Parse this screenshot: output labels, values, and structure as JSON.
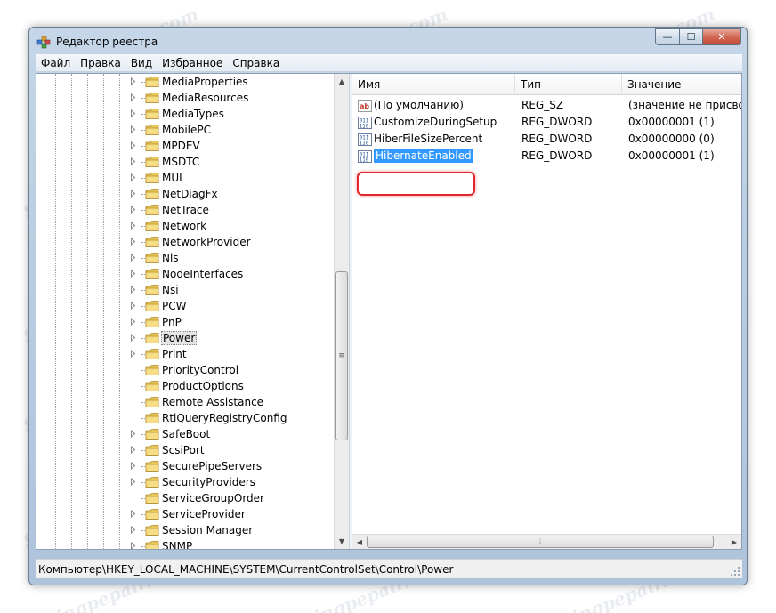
{
  "window": {
    "title": "Редактор реестра",
    "buttons": {
      "minimize": "—",
      "maximize": "☐",
      "close": "✕"
    }
  },
  "menu": [
    "Файл",
    "Правка",
    "Вид",
    "Избранное",
    "Справка"
  ],
  "tree": {
    "items": [
      {
        "label": "MediaProperties",
        "expandable": true
      },
      {
        "label": "MediaResources",
        "expandable": true
      },
      {
        "label": "MediaTypes",
        "expandable": true
      },
      {
        "label": "MobilePC",
        "expandable": true
      },
      {
        "label": "MPDEV",
        "expandable": true
      },
      {
        "label": "MSDTC",
        "expandable": true
      },
      {
        "label": "MUI",
        "expandable": true
      },
      {
        "label": "NetDiagFx",
        "expandable": true
      },
      {
        "label": "NetTrace",
        "expandable": true
      },
      {
        "label": "Network",
        "expandable": true
      },
      {
        "label": "NetworkProvider",
        "expandable": true
      },
      {
        "label": "Nls",
        "expandable": true
      },
      {
        "label": "NodeInterfaces",
        "expandable": true
      },
      {
        "label": "Nsi",
        "expandable": true
      },
      {
        "label": "PCW",
        "expandable": true
      },
      {
        "label": "PnP",
        "expandable": true
      },
      {
        "label": "Power",
        "expandable": true,
        "selected": true
      },
      {
        "label": "Print",
        "expandable": true
      },
      {
        "label": "PriorityControl",
        "expandable": false
      },
      {
        "label": "ProductOptions",
        "expandable": false
      },
      {
        "label": "Remote Assistance",
        "expandable": false
      },
      {
        "label": "RtlQueryRegistryConfig",
        "expandable": false
      },
      {
        "label": "SafeBoot",
        "expandable": true
      },
      {
        "label": "ScsiPort",
        "expandable": true
      },
      {
        "label": "SecurePipeServers",
        "expandable": true
      },
      {
        "label": "SecurityProviders",
        "expandable": true
      },
      {
        "label": "ServiceGroupOrder",
        "expandable": false
      },
      {
        "label": "ServiceProvider",
        "expandable": true
      },
      {
        "label": "Session Manager",
        "expandable": true
      },
      {
        "label": "SNMP",
        "expandable": true
      }
    ]
  },
  "values": {
    "columns": [
      "Имя",
      "Тип",
      "Значение"
    ],
    "rows": [
      {
        "name": "(По умолчанию)",
        "type": "REG_SZ",
        "data": "(значение не присвоено)",
        "icon": "string-value-icon"
      },
      {
        "name": "CustomizeDuringSetup",
        "type": "REG_DWORD",
        "data": "0x00000001 (1)",
        "icon": "binary-value-icon"
      },
      {
        "name": "HiberFileSizePercent",
        "type": "REG_DWORD",
        "data": "0x00000000 (0)",
        "icon": "binary-value-icon"
      },
      {
        "name": "HibernateEnabled",
        "type": "REG_DWORD",
        "data": "0x00000001 (1)",
        "icon": "binary-value-icon",
        "selected": true
      }
    ]
  },
  "statusbar": {
    "path": "Компьютер\\HKEY_LOCAL_MACHINE\\SYSTEM\\CurrentControlSet\\Control\\Power"
  },
  "watermark": "Sovingpepair.com",
  "colors": {
    "selection": "#3399ff",
    "highlight_ring": "#e3262e",
    "title_gradient": "#b9cde2"
  }
}
